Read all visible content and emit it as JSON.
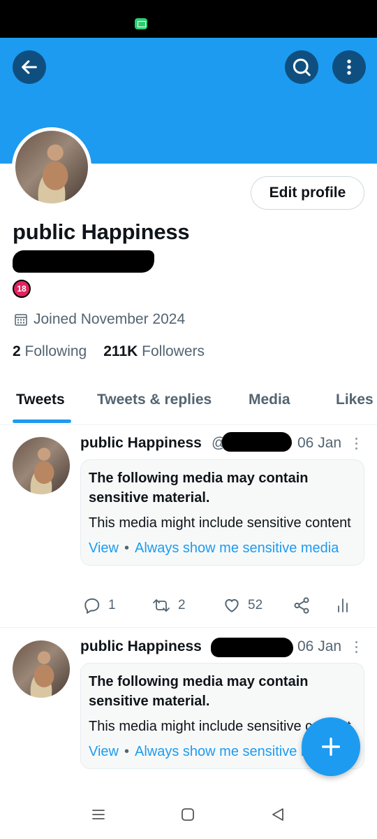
{
  "profile": {
    "display_name": "public Happiness",
    "edit_label": "Edit profile",
    "badge": "18",
    "joined": "Joined November 2024",
    "following_count": "2",
    "following_label": "Following",
    "followers_count": "211K",
    "followers_label": "Followers"
  },
  "tabs": [
    {
      "label": "Tweets",
      "active": true
    },
    {
      "label": "Tweets & replies",
      "active": false
    },
    {
      "label": "Media",
      "active": false
    },
    {
      "label": "Likes",
      "active": false
    }
  ],
  "tweets": [
    {
      "name": "public Happiness",
      "at": "@",
      "date": "06 Jan",
      "sensitive_title": "The following media may contain sensitive material.",
      "sensitive_body": "This media might include sensitive content",
      "view_label": "View",
      "always_label": "Always show me sensitive media",
      "replies": "1",
      "retweets": "2",
      "likes": "52"
    },
    {
      "name": "public Happiness",
      "date": "06 Jan",
      "sensitive_title": "The following media may contain sensitive material.",
      "sensitive_body": "This media might include sensitive content",
      "view_label": "View",
      "always_label": "Always show me sensitive media"
    }
  ],
  "colors": {
    "accent": "#1d9bf0",
    "header_button": "#0f4f80",
    "muted_text": "#536471"
  },
  "icons": {
    "back": "arrow-left-icon",
    "search": "search-icon",
    "more": "more-vertical-icon",
    "calendar": "calendar-icon",
    "reply": "reply-icon",
    "retweet": "retweet-icon",
    "like": "heart-icon",
    "share": "share-icon",
    "analytics": "analytics-icon",
    "compose": "plus-icon"
  }
}
